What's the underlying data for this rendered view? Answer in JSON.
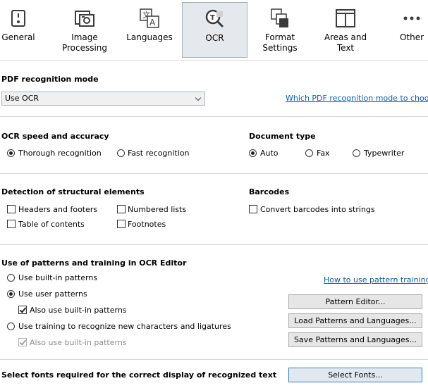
{
  "toolbar": {
    "tabs": [
      {
        "label": "General",
        "icon": "general-icon",
        "selected": false
      },
      {
        "label": "Image Processing",
        "icon": "image-processing-icon",
        "selected": false
      },
      {
        "label": "Languages",
        "icon": "languages-icon",
        "selected": false
      },
      {
        "label": "OCR",
        "icon": "ocr-magnifier-icon",
        "selected": true
      },
      {
        "label": "Format Settings",
        "icon": "format-settings-icon",
        "selected": false
      },
      {
        "label": "Areas and Text",
        "icon": "areas-text-icon",
        "selected": false
      },
      {
        "label": "Other",
        "icon": "more-dots-icon",
        "selected": false
      }
    ]
  },
  "pdf_mode": {
    "heading": "PDF recognition mode",
    "selected_value": "Use OCR",
    "help_link": "Which PDF recognition mode to choose?"
  },
  "ocr_speed": {
    "heading": "OCR speed and accuracy",
    "options": [
      {
        "label": "Thorough recognition",
        "checked": true
      },
      {
        "label": "Fast recognition",
        "checked": false
      }
    ]
  },
  "document_type": {
    "heading": "Document type",
    "options": [
      {
        "label": "Auto",
        "checked": true
      },
      {
        "label": "Fax",
        "checked": false
      },
      {
        "label": "Typewriter",
        "checked": false
      }
    ]
  },
  "structural": {
    "heading": "Detection of structural elements",
    "items": [
      {
        "label": "Headers and footers",
        "checked": false
      },
      {
        "label": "Numbered lists",
        "checked": false
      },
      {
        "label": "Table of contents",
        "checked": false
      },
      {
        "label": "Footnotes",
        "checked": false
      }
    ]
  },
  "barcodes": {
    "heading": "Barcodes",
    "convert_label": "Convert barcodes into strings",
    "checked": false
  },
  "patterns": {
    "heading": "Use of patterns and training in OCR Editor",
    "help_link": "How to use pattern training?",
    "opt_builtin": "Use built-in patterns",
    "opt_user": "Use user patterns",
    "also_builtin_1": "Also use built-in patterns",
    "opt_training": "Use training to recognize new characters and ligatures",
    "also_builtin_2": "Also use built-in patterns",
    "btn_editor": "Pattern Editor...",
    "btn_load": "Load Patterns and Languages...",
    "btn_save": "Save Patterns and Languages..."
  },
  "fonts": {
    "label": "Select fonts required for the correct display of recognized text",
    "button": "Select Fonts..."
  }
}
